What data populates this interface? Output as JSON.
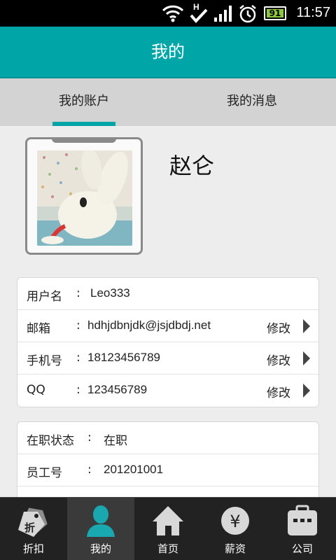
{
  "status_bar": {
    "time": "11:57",
    "battery": "91"
  },
  "header": {
    "title": "我的"
  },
  "tabs": [
    {
      "label": "我的账户",
      "active": true
    },
    {
      "label": "我的消息",
      "active": false
    }
  ],
  "profile": {
    "name": "赵仑"
  },
  "account_card": {
    "rows": [
      {
        "label": "用户名",
        "sep": ":",
        "value": "Leo333",
        "action": ""
      },
      {
        "label": "邮箱",
        "sep": ":",
        "value": "hdhjdbnjdk@jsjdbdj.net",
        "action": "修改"
      },
      {
        "label": "手机号",
        "sep": ":",
        "value": "18123456789",
        "action": "修改"
      },
      {
        "label": "QQ",
        "sep": ":",
        "value": "123456789",
        "action": "修改"
      }
    ]
  },
  "job_card": {
    "rows": [
      {
        "label": "在职状态",
        "sep": ":",
        "value": "在职"
      },
      {
        "label": "员工号",
        "sep": ":",
        "value": "201201001"
      }
    ]
  },
  "bottom_nav": [
    {
      "label": "折扣",
      "icon": "discount-tag-icon",
      "active": false
    },
    {
      "label": "我的",
      "icon": "person-icon",
      "active": true
    },
    {
      "label": "首页",
      "icon": "home-icon",
      "active": false
    },
    {
      "label": "薪资",
      "icon": "yen-coin-icon",
      "active": false
    },
    {
      "label": "公司",
      "icon": "briefcase-icon",
      "active": false
    }
  ],
  "colors": {
    "accent": "#00a5a8"
  }
}
